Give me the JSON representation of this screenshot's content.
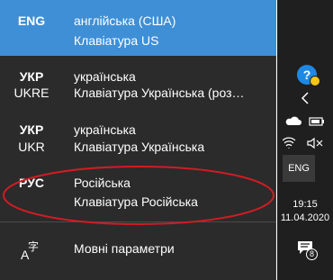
{
  "languages": [
    {
      "code": "ENG",
      "sub": "",
      "name": "англійська (США)",
      "keyboard": "Клавіатура US",
      "selected": true
    },
    {
      "code": "УКР",
      "sub": "UKRE",
      "name": "українська",
      "keyboard": "Клавіатура Українська (роз…",
      "selected": false
    },
    {
      "code": "УКР",
      "sub": "UKR",
      "name": "українська",
      "keyboard": "Клавіатура Українська",
      "selected": false
    },
    {
      "code": "РУС",
      "sub": "",
      "name": "Російська",
      "keyboard": "Клавіатура Російська",
      "selected": false
    }
  ],
  "settings": {
    "icon": "language-settings-icon",
    "label": "Мовні параметри"
  },
  "taskbar": {
    "language": "ENG",
    "time": "19:15",
    "date": "11.04.2020",
    "notification_count": "8"
  },
  "colors": {
    "flyout_bg": "#2b2b2b",
    "selected_bg": "#3f8fd6",
    "taskbar_bg": "#1f1f1f",
    "annotation": "#d01c24"
  }
}
